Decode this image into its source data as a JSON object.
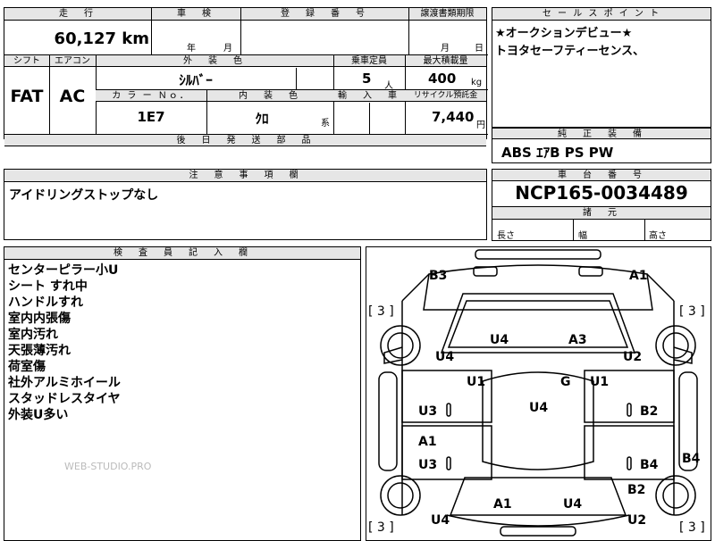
{
  "top": {
    "mileage_header": "走　行",
    "mileage_value": "60,127 km",
    "inspection_header": "車　検",
    "inspection_year": "年",
    "inspection_month": "月",
    "reg_header": "登　録　番　号",
    "transfer_header": "譲渡書類期限",
    "transfer_month": "月",
    "transfer_day": "日",
    "shift_header": "シフト",
    "shift_value": "FAT",
    "ac_header": "エアコン",
    "ac_value": "AC",
    "exterior_header": "外　装　色",
    "exterior_value": "ｼﾙﾊﾞｰ",
    "capacity_header": "乗車定員",
    "capacity_value": "5",
    "capacity_unit": "人",
    "load_header": "最大積載量",
    "load_value": "400",
    "load_unit": "kg",
    "color_no_header": "カ ラ ー Ｎｏ．",
    "color_no_value": "1E7",
    "interior_header": "内　装　色",
    "interior_value": "ｸﾛ",
    "interior_suffix": "系",
    "import_header": "輸　入　車",
    "recycle_header": "リサイクル預託金",
    "recycle_value": "7,440",
    "recycle_unit": "円",
    "parts_header": "後　日　発　送　部　品"
  },
  "sales": {
    "header": "セ ー ル ス ポ イ ン ト",
    "line1": "★オークションデビュー★",
    "line2": "トヨタセーフティーセンス、"
  },
  "equipment": {
    "header": "純　正　装　備",
    "value": "ABS ｴｱB PS PW"
  },
  "notes": {
    "header": "注　意　事　項　欄",
    "value": "アイドリングストップなし"
  },
  "chassis": {
    "header": "車　台　番　号",
    "value": "NCP165-0034489"
  },
  "dims": {
    "header": "諸　元",
    "length": "長さ",
    "width": "幅",
    "height": "高さ"
  },
  "inspector": {
    "header": "検　査　員　記　入　欄",
    "lines": [
      "センターピラー小U",
      "シート すれ中",
      "ハンドルすれ",
      "室内内張傷",
      "室内汚れ",
      "天張薄汚れ",
      "荷室傷",
      "社外アルミホイール",
      "スタッドレスタイヤ",
      "外装U多い"
    ]
  },
  "watermark": "WEB-STUDIO.PRO",
  "diagram": {
    "labels": [
      {
        "key": "b3",
        "text": "B3"
      },
      {
        "key": "a1_top",
        "text": "A1"
      },
      {
        "key": "u4_a",
        "text": "U4"
      },
      {
        "key": "a3",
        "text": "A3"
      },
      {
        "key": "u4_b",
        "text": "U4"
      },
      {
        "key": "u2_a",
        "text": "U2"
      },
      {
        "key": "u1_a",
        "text": "U1"
      },
      {
        "key": "g",
        "text": "G"
      },
      {
        "key": "u1_b",
        "text": "U1"
      },
      {
        "key": "u4_c",
        "text": "U4"
      },
      {
        "key": "u3_a",
        "text": "U3"
      },
      {
        "key": "b2_a",
        "text": "B2"
      },
      {
        "key": "a1_b",
        "text": "A1"
      },
      {
        "key": "u3_b",
        "text": "U3"
      },
      {
        "key": "b4_a",
        "text": "B4"
      },
      {
        "key": "b4_b",
        "text": "B4"
      },
      {
        "key": "b2_b",
        "text": "B2"
      },
      {
        "key": "a1_c",
        "text": "A1"
      },
      {
        "key": "u4_d",
        "text": "U4"
      },
      {
        "key": "u4_e",
        "text": "U4"
      },
      {
        "key": "u2_b",
        "text": "U2"
      }
    ],
    "tire_marks": [
      "[ 3 ]",
      "[ 3 ]",
      "[ 3 ]",
      "[ 3 ]"
    ]
  }
}
